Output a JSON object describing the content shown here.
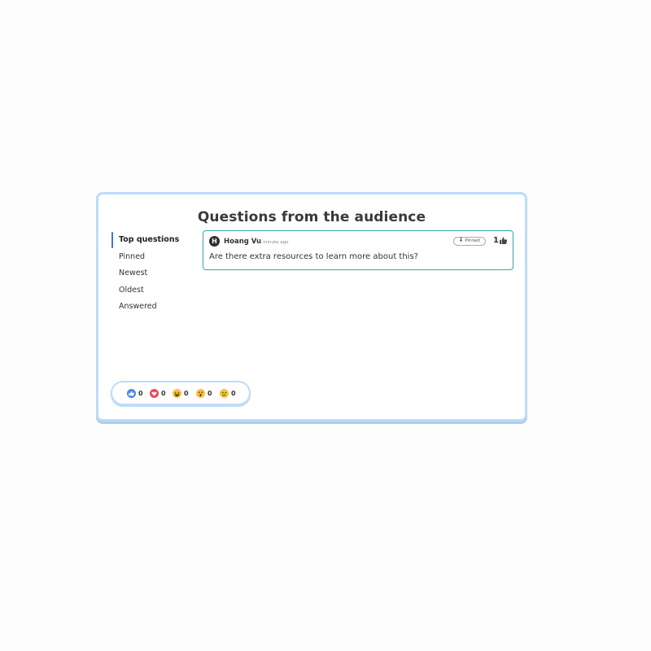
{
  "panel": {
    "title": "Questions from the audience"
  },
  "tabs": [
    {
      "label": "Top questions",
      "active": true
    },
    {
      "label": "Pinned",
      "active": false
    },
    {
      "label": "Newest",
      "active": false
    },
    {
      "label": "Oldest",
      "active": false
    },
    {
      "label": "Answered",
      "active": false
    }
  ],
  "questions": [
    {
      "avatar_initial": "H",
      "author": "Hoang Vu",
      "time": "a minute ago",
      "pin_label": "Pinned",
      "pin_icon": "pin-icon",
      "upvotes": "1",
      "upvote_icon": "thumbs-up-icon",
      "text": "Are there extra resources to learn more about this?"
    }
  ],
  "reactions": [
    {
      "icon": "like-icon",
      "count": "0",
      "color": "#4a86e8"
    },
    {
      "icon": "heart-icon",
      "count": "0",
      "color": "#e84a5f"
    },
    {
      "icon": "laugh-icon",
      "count": "0",
      "color": "#f5c242"
    },
    {
      "icon": "wow-icon",
      "count": "0",
      "color": "#f5c242"
    },
    {
      "icon": "sad-icon",
      "count": "0",
      "color": "#f5c242"
    }
  ],
  "colors": {
    "accent": "#4a6fd1",
    "card_border": "#3aa0b4",
    "panel_border": "#bcdcf7"
  }
}
